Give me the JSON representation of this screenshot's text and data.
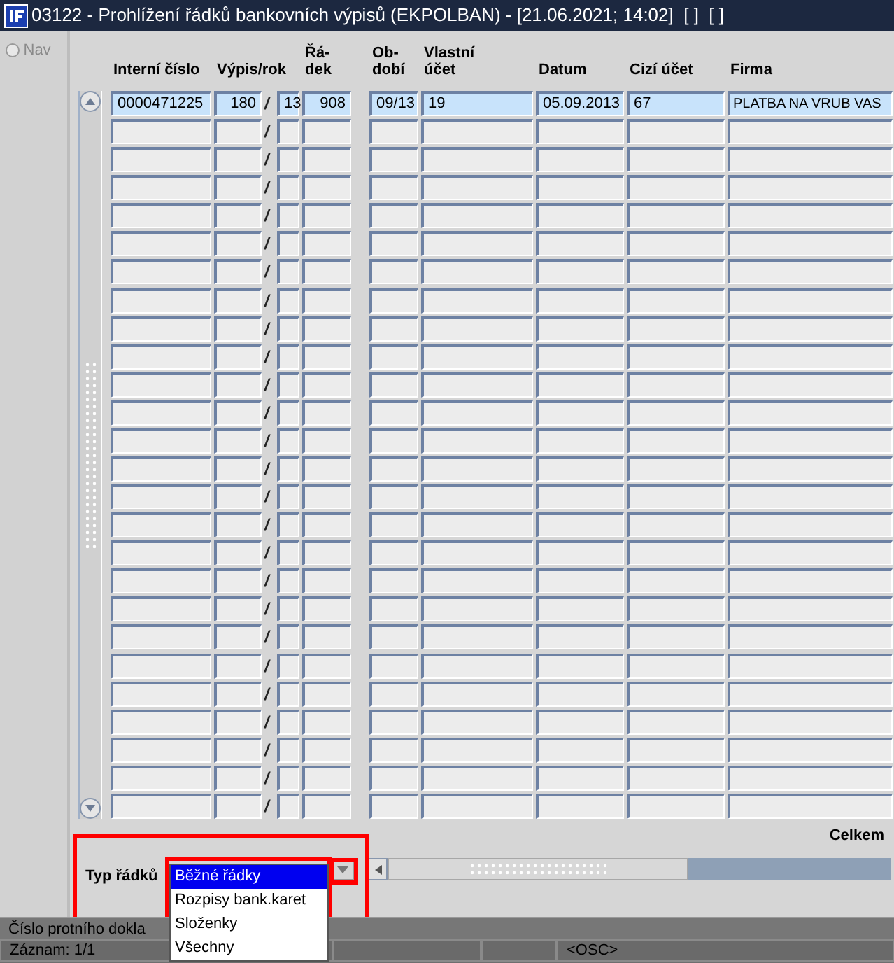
{
  "window": {
    "title": "03122 - Prohlížení řádků bankovních výpisů (EKPOLBAN) - [21.06.2021; 14:02]  [ ]  [ ]"
  },
  "nav": {
    "label": "Nav",
    "disabled": true
  },
  "table": {
    "columns": [
      {
        "label": "Interní číslo"
      },
      {
        "label": "Výpis/rok"
      },
      {
        "label": "Řá-\ndek"
      },
      {
        "label": "Ob-\ndobí"
      },
      {
        "label": "Vlastní\núčet"
      },
      {
        "label": "Datum"
      },
      {
        "label": "Cizí účet"
      },
      {
        "label": "Firma"
      }
    ],
    "rows": [
      {
        "selected": true,
        "interni_cislo": "0000471225",
        "vypis": "180",
        "separator": "/",
        "rok": "13",
        "radek": "908",
        "obdobi": "09/13",
        "vlastni_ucet": "19",
        "datum": "05.09.2013",
        "cizi_ucet": "67",
        "firma": "PLATBA NA VRUB VAS"
      },
      {
        "selected": false,
        "separator": "/"
      },
      {
        "selected": false,
        "separator": "/"
      },
      {
        "selected": false,
        "separator": "/"
      },
      {
        "selected": false,
        "separator": "/"
      },
      {
        "selected": false,
        "separator": "/"
      },
      {
        "selected": false,
        "separator": "/"
      },
      {
        "selected": false,
        "separator": "/"
      },
      {
        "selected": false,
        "separator": "/"
      },
      {
        "selected": false,
        "separator": "/"
      },
      {
        "selected": false,
        "separator": "/"
      },
      {
        "selected": false,
        "separator": "/"
      },
      {
        "selected": false,
        "separator": "/"
      },
      {
        "selected": false,
        "separator": "/"
      },
      {
        "selected": false,
        "separator": "/"
      },
      {
        "selected": false,
        "separator": "/"
      },
      {
        "selected": false,
        "separator": "/"
      },
      {
        "selected": false,
        "separator": "/"
      },
      {
        "selected": false,
        "separator": "/"
      },
      {
        "selected": false,
        "separator": "/"
      },
      {
        "selected": false,
        "separator": "/"
      },
      {
        "selected": false,
        "separator": "/"
      },
      {
        "selected": false,
        "separator": "/"
      },
      {
        "selected": false,
        "separator": "/"
      },
      {
        "selected": false,
        "separator": "/"
      },
      {
        "selected": false,
        "separator": "/"
      }
    ],
    "total_label": "Celkem"
  },
  "row_type": {
    "label": "Typ řádků",
    "options": [
      {
        "label": "Běžné řádky",
        "selected": true
      },
      {
        "label": "Rozpisy bank.karet",
        "selected": false
      },
      {
        "label": "Složenky",
        "selected": false
      },
      {
        "label": "Všechny",
        "selected": false
      }
    ]
  },
  "status_bar": {
    "message": "Číslo protního dokla",
    "record": "Záznam: 1/1",
    "mode": "<OSC>"
  }
}
